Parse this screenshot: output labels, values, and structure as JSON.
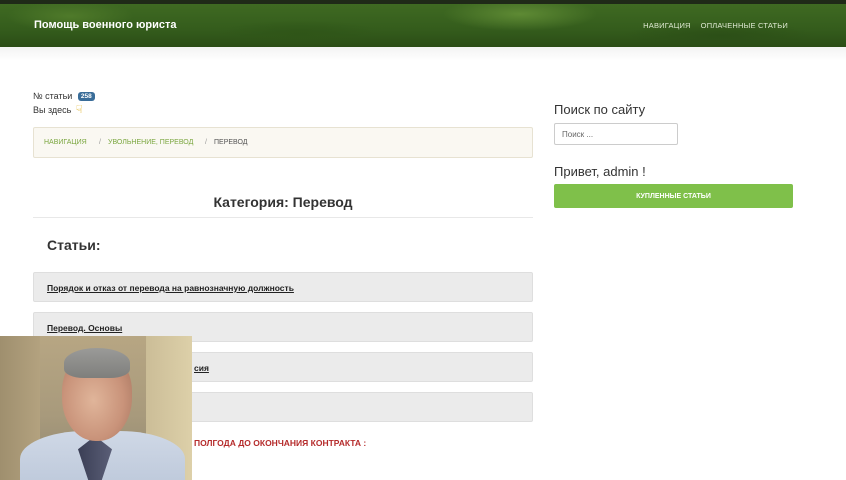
{
  "header": {
    "site_title": "Помощь военного юриста",
    "nav": [
      "НАВИГАЦИЯ",
      "ОПЛАЧЕННЫЕ СТАТЬИ"
    ]
  },
  "article_info": {
    "number_label": "№ статьи",
    "number_value": "258",
    "you_are_here": "Вы здесь"
  },
  "breadcrumb": {
    "items": [
      {
        "label": "НАВИГАЦИЯ"
      },
      {
        "label": "УВОЛЬНЕНИЕ, ПЕРЕВОД"
      },
      {
        "label": "ПЕРЕВОД"
      }
    ],
    "separator": "/"
  },
  "category": {
    "title": "Категория: Перевод",
    "articles_heading": "Статьи:"
  },
  "articles": [
    {
      "title": "Порядок и отказ от перевода на равнозначную должность"
    },
    {
      "title": "Перевод. Основы"
    },
    {
      "title": "сия"
    },
    {
      "title": ""
    }
  ],
  "note": {
    "text": "ПОЛГОДА ДО ОКОНЧАНИЯ КОНТРАКТА :"
  },
  "sidebar": {
    "search_title": "Поиск по сайту",
    "search_placeholder": "Поиск ...",
    "greeting": "Привет, admin !",
    "bought_button": "КУПЛЕННЫЕ СТАТЬИ"
  },
  "colors": {
    "accent_green": "#7fc04a",
    "link_green": "#7ba740",
    "warning_red": "#b52b2b",
    "badge_blue": "#3a6d99"
  }
}
